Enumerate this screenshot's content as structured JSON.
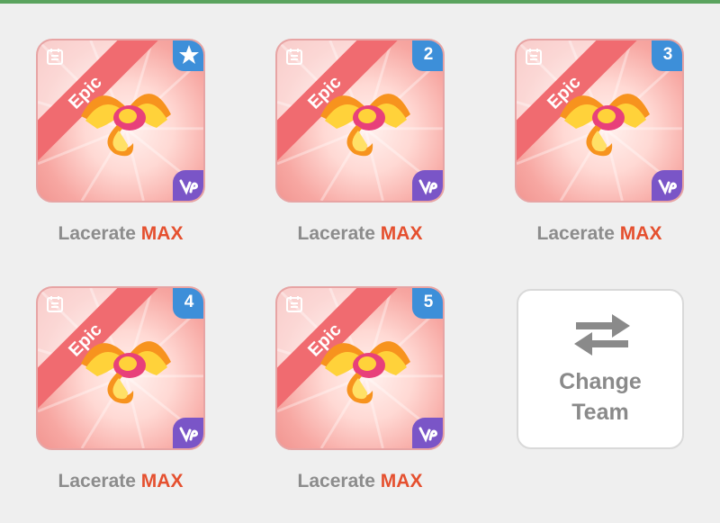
{
  "colors": {
    "top_border": "#5aa35e",
    "card_ribbon": "#f06b70",
    "slot_badge": "#3d8fd9",
    "element_badge": "#7a55c7",
    "label_name": "#8c8c8c",
    "label_max": "#e5502f"
  },
  "team": [
    {
      "rarity": "Epic",
      "slot": "★",
      "slot_icon": "star-icon",
      "name": "Lacerate",
      "level": "MAX"
    },
    {
      "rarity": "Epic",
      "slot": "2",
      "slot_icon": "number",
      "name": "Lacerate",
      "level": "MAX"
    },
    {
      "rarity": "Epic",
      "slot": "3",
      "slot_icon": "number",
      "name": "Lacerate",
      "level": "MAX"
    },
    {
      "rarity": "Epic",
      "slot": "4",
      "slot_icon": "number",
      "name": "Lacerate",
      "level": "MAX"
    },
    {
      "rarity": "Epic",
      "slot": "5",
      "slot_icon": "number",
      "name": "Lacerate",
      "level": "MAX"
    }
  ],
  "change_team": {
    "icon": "swap-arrows-icon",
    "line1": "Change",
    "line2": "Team"
  }
}
